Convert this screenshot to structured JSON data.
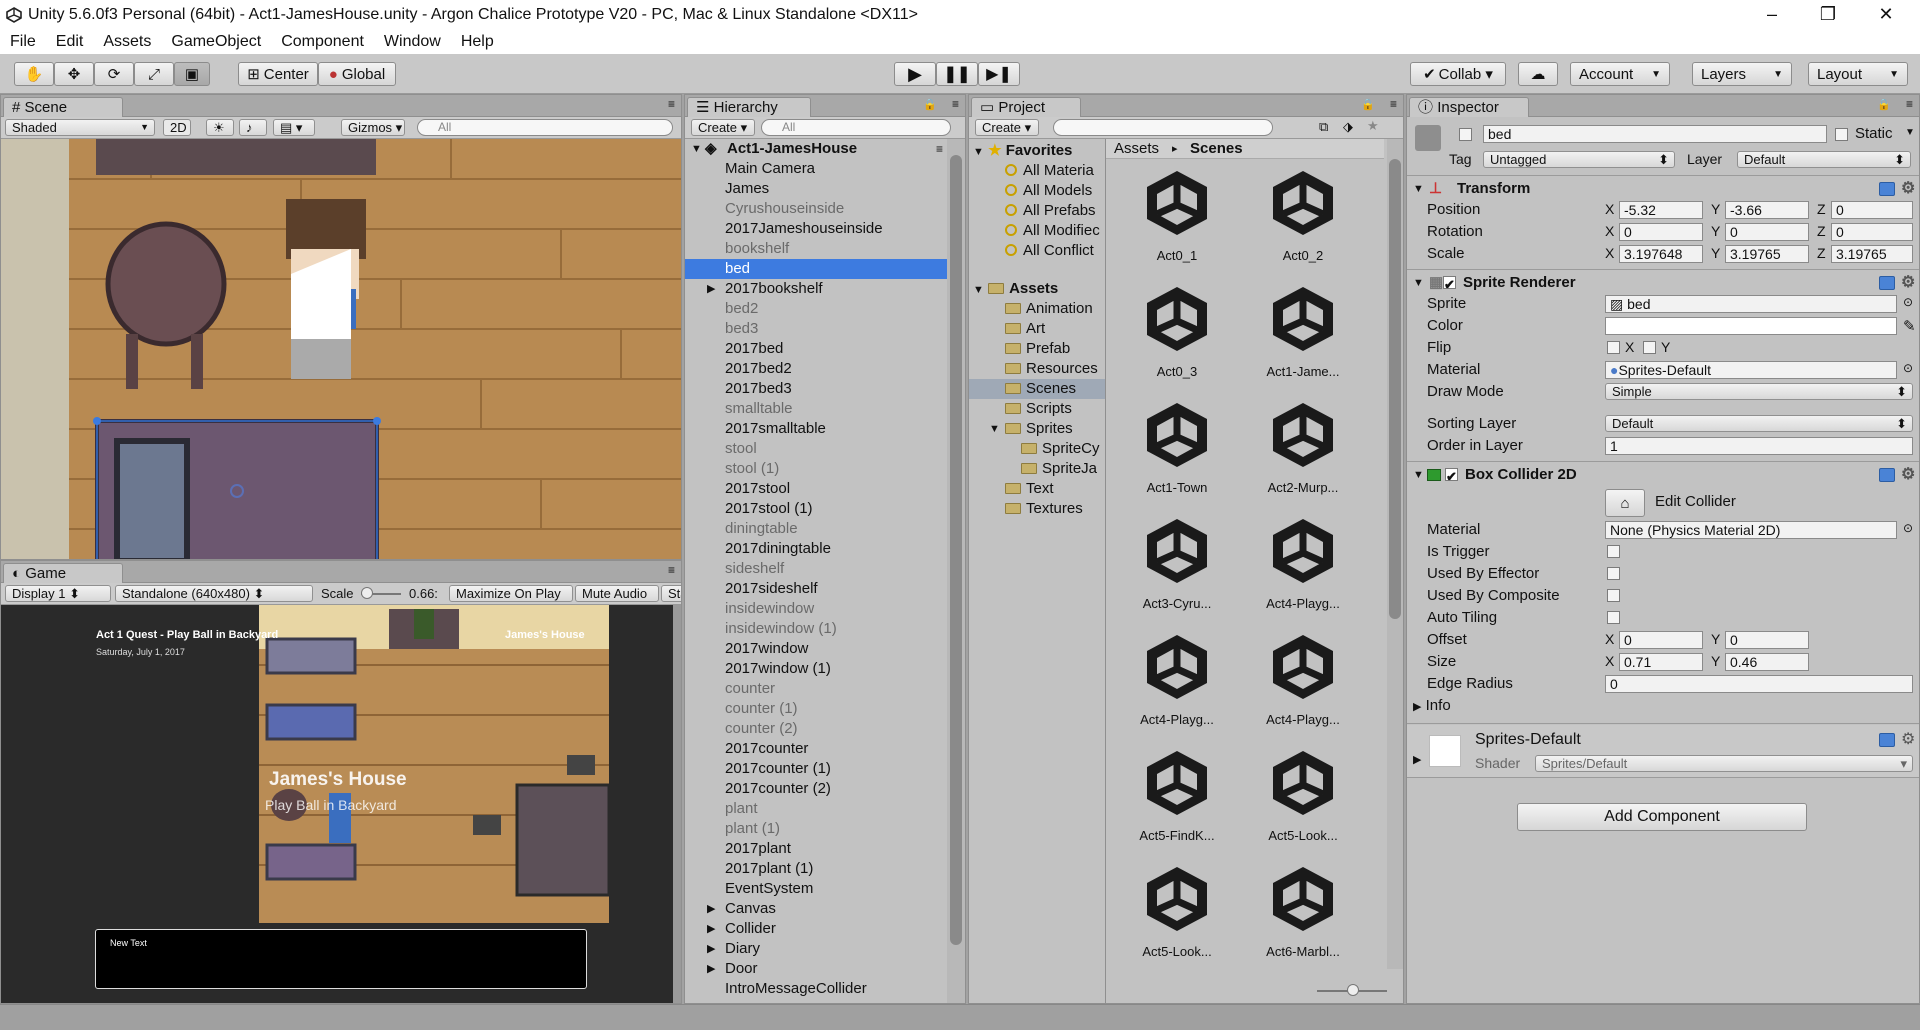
{
  "window": {
    "title": "Unity 5.6.0f3 Personal (64bit) - Act1-JamesHouse.unity - Argon Chalice Prototype V20 - PC, Mac & Linux Standalone <DX11>",
    "minimize": "–",
    "maximize": "❐",
    "close": "✕"
  },
  "menu": [
    "File",
    "Edit",
    "Assets",
    "GameObject",
    "Component",
    "Window",
    "Help"
  ],
  "toolbar": {
    "center_label": "Center",
    "global_label": "Global",
    "collab_label": "Collab ▾",
    "account_label": "Account",
    "layers_label": "Layers",
    "layout_label": "Layout"
  },
  "scene": {
    "tab": "Scene",
    "shading": "Shaded",
    "mode_2d": "2D",
    "gizmos": "Gizmos",
    "search_placeholder": "All"
  },
  "game": {
    "tab": "Game",
    "display": "Display 1",
    "resolution": "Standalone (640x480)",
    "scale_label": "Scale",
    "scale_value": "0.66:",
    "maximize": "Maximize On Play",
    "mute": "Mute Audio",
    "stats": "Sta",
    "quest_title": "Act 1 Quest - Play Ball in Backyard",
    "quest_date": "Saturday, July 1, 2017",
    "location_small": "James's House",
    "location_big": "James's House",
    "location_sub": "Play Ball in Backyard",
    "dialog_text": "New Text"
  },
  "hierarchy": {
    "tab": "Hierarchy",
    "create": "Create",
    "search_placeholder": "All",
    "scene_name": "Act1-JamesHouse",
    "items": [
      {
        "label": "Main Camera",
        "dim": false,
        "arrow": false
      },
      {
        "label": "James",
        "dim": false,
        "arrow": false
      },
      {
        "label": "Cyrushouseinside",
        "dim": true,
        "arrow": false
      },
      {
        "label": "2017Jameshouseinside",
        "dim": false,
        "arrow": false
      },
      {
        "label": "bookshelf",
        "dim": true,
        "arrow": false
      },
      {
        "label": "bed",
        "dim": true,
        "arrow": false,
        "selected": true
      },
      {
        "label": "2017bookshelf",
        "dim": false,
        "arrow": true
      },
      {
        "label": "bed2",
        "dim": true,
        "arrow": false
      },
      {
        "label": "bed3",
        "dim": true,
        "arrow": false
      },
      {
        "label": "2017bed",
        "dim": false,
        "arrow": false
      },
      {
        "label": "2017bed2",
        "dim": false,
        "arrow": false
      },
      {
        "label": "2017bed3",
        "dim": false,
        "arrow": false
      },
      {
        "label": "smalltable",
        "dim": true,
        "arrow": false
      },
      {
        "label": "2017smalltable",
        "dim": false,
        "arrow": false
      },
      {
        "label": "stool",
        "dim": true,
        "arrow": false
      },
      {
        "label": "stool (1)",
        "dim": true,
        "arrow": false
      },
      {
        "label": "2017stool",
        "dim": false,
        "arrow": false
      },
      {
        "label": "2017stool (1)",
        "dim": false,
        "arrow": false
      },
      {
        "label": "diningtable",
        "dim": true,
        "arrow": false
      },
      {
        "label": "2017diningtable",
        "dim": false,
        "arrow": false
      },
      {
        "label": "sideshelf",
        "dim": true,
        "arrow": false
      },
      {
        "label": "2017sideshelf",
        "dim": false,
        "arrow": false
      },
      {
        "label": "insidewindow",
        "dim": true,
        "arrow": false
      },
      {
        "label": "insidewindow (1)",
        "dim": true,
        "arrow": false
      },
      {
        "label": "2017window",
        "dim": false,
        "arrow": false
      },
      {
        "label": "2017window (1)",
        "dim": false,
        "arrow": false
      },
      {
        "label": "counter",
        "dim": true,
        "arrow": false
      },
      {
        "label": "counter (1)",
        "dim": true,
        "arrow": false
      },
      {
        "label": "counter (2)",
        "dim": true,
        "arrow": false
      },
      {
        "label": "2017counter",
        "dim": false,
        "arrow": false
      },
      {
        "label": "2017counter (1)",
        "dim": false,
        "arrow": false
      },
      {
        "label": "2017counter (2)",
        "dim": false,
        "arrow": false
      },
      {
        "label": "plant",
        "dim": true,
        "arrow": false
      },
      {
        "label": "plant (1)",
        "dim": true,
        "arrow": false
      },
      {
        "label": "2017plant",
        "dim": false,
        "arrow": false
      },
      {
        "label": "2017plant (1)",
        "dim": false,
        "arrow": false
      },
      {
        "label": "EventSystem",
        "dim": false,
        "arrow": false
      },
      {
        "label": "Canvas",
        "dim": false,
        "arrow": true
      },
      {
        "label": "Collider",
        "dim": false,
        "arrow": true
      },
      {
        "label": "Diary",
        "dim": false,
        "arrow": true
      },
      {
        "label": "Door",
        "dim": false,
        "arrow": true
      },
      {
        "label": "IntroMessageCollider",
        "dim": false,
        "arrow": false
      }
    ]
  },
  "project": {
    "tab": "Project",
    "create": "Create",
    "favorites_label": "Favorites",
    "favorites": [
      "All Materia",
      "All Models",
      "All Prefabs",
      "All Modifiec",
      "All Conflict"
    ],
    "assets_label": "Assets",
    "folders": [
      {
        "label": "Animation",
        "indent": 1
      },
      {
        "label": "Art",
        "indent": 1
      },
      {
        "label": "Prefab",
        "indent": 1
      },
      {
        "label": "Resources",
        "indent": 1
      },
      {
        "label": "Scenes",
        "indent": 1,
        "selected": true
      },
      {
        "label": "Scripts",
        "indent": 1
      },
      {
        "label": "Sprites",
        "indent": 1,
        "open": true
      },
      {
        "label": "SpriteCy",
        "indent": 2
      },
      {
        "label": "SpriteJa",
        "indent": 2
      },
      {
        "label": "Text",
        "indent": 1
      },
      {
        "label": "Textures",
        "indent": 1
      }
    ],
    "breadcrumb_root": "Assets",
    "breadcrumb_sep": "▸",
    "breadcrumb_current": "Scenes",
    "scene_files": [
      "Act0_1",
      "Act0_2",
      "Act0_3",
      "Act1-Jame...",
      "Act1-Town",
      "Act2-Murp...",
      "Act3-Cyru...",
      "Act4-Playg...",
      "Act4-Playg...",
      "Act4-Playg...",
      "Act5-FindK...",
      "Act5-Look...",
      "Act5-Look...",
      "Act6-Marbl..."
    ]
  },
  "inspector": {
    "tab": "Inspector",
    "object_name": "bed",
    "static_label": "Static",
    "tag_label": "Tag",
    "tag_value": "Untagged",
    "layer_label": "Layer",
    "layer_value": "Default",
    "transform": {
      "title": "Transform",
      "position_label": "Position",
      "position": {
        "x": "-5.32",
        "y": "-3.66",
        "z": "0"
      },
      "rotation_label": "Rotation",
      "rotation": {
        "x": "0",
        "y": "0",
        "z": "0"
      },
      "scale_label": "Scale",
      "scale": {
        "x": "3.197648",
        "y": "3.19765",
        "z": "3.19765"
      }
    },
    "sprite_renderer": {
      "title": "Sprite Renderer",
      "sprite_label": "Sprite",
      "sprite_value": "bed",
      "color_label": "Color",
      "flip_label": "Flip",
      "flip_x": "X",
      "flip_y": "Y",
      "material_label": "Material",
      "material_value": "Sprites-Default",
      "draw_mode_label": "Draw Mode",
      "draw_mode_value": "Simple",
      "sorting_layer_label": "Sorting Layer",
      "sorting_layer_value": "Default",
      "order_label": "Order in Layer",
      "order_value": "1"
    },
    "box_collider": {
      "title": "Box Collider 2D",
      "edit_label": "Edit Collider",
      "material_label": "Material",
      "material_value": "None (Physics Material 2D)",
      "is_trigger_label": "Is Trigger",
      "used_by_effector_label": "Used By Effector",
      "used_by_composite_label": "Used By Composite",
      "auto_tiling_label": "Auto Tiling",
      "offset_label": "Offset",
      "offset": {
        "x": "0",
        "y": "0"
      },
      "size_label": "Size",
      "size": {
        "x": "0.71",
        "y": "0.46"
      },
      "edge_radius_label": "Edge Radius",
      "edge_radius_value": "0",
      "info_label": "Info"
    },
    "material": {
      "name": "Sprites-Default",
      "shader_label": "Shader",
      "shader_value": "Sprites/Default"
    },
    "add_component": "Add Component"
  }
}
